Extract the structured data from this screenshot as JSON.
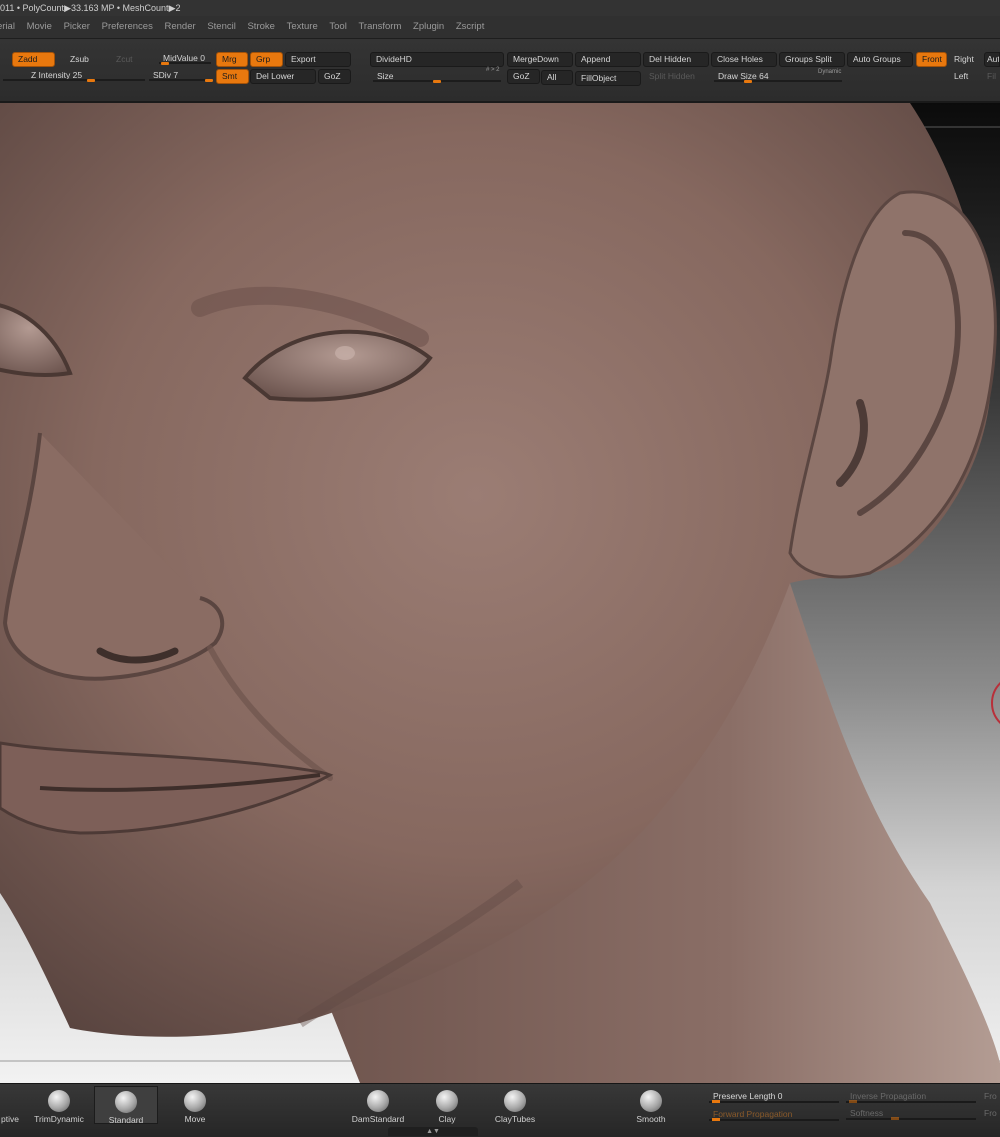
{
  "status": {
    "left_fragment": "011",
    "polycount_label": "PolyCount",
    "polycount_value": "33.163 MP",
    "meshcount_label": "MeshCount",
    "meshcount_value": "2"
  },
  "menu": [
    "erial",
    "Movie",
    "Picker",
    "Preferences",
    "Render",
    "Stencil",
    "Stroke",
    "Texture",
    "Tool",
    "Transform",
    "Zplugin",
    "Zscript"
  ],
  "toolbar": {
    "zadd": "Zadd",
    "zsub": "Zsub",
    "zcut": "Zcut",
    "z_intensity_label": "Z Intensity",
    "z_intensity_value": 25,
    "midvalue_label": "MidValue",
    "midvalue_value": 0,
    "sdiv_label": "SDiv",
    "sdiv_value": 7,
    "mrg": "Mrg",
    "grp": "Grp",
    "export": "Export",
    "smt": "Smt",
    "del_lower": "Del Lower",
    "goz_1": "GoZ",
    "dividehd": "DivideHD",
    "size_label": "Size",
    "size_hint": "# > 2",
    "mergedown": "MergeDown",
    "append": "Append",
    "goz_2": "GoZ",
    "all": "All",
    "fillobject": "FillObject",
    "del_hidden": "Del Hidden",
    "split_hidden": "Split Hidden",
    "close_holes": "Close Holes",
    "groups_split": "Groups Split",
    "auto_groups": "Auto Groups",
    "draw_size_label": "Draw Size",
    "draw_size_value": 64,
    "dynamic": "Dynamic",
    "front": "Front",
    "right": "Right",
    "left": "Left",
    "aut_fragment": "Aut",
    "fil_fragment": "Fil"
  },
  "brushes": [
    "ptive",
    "TrimDynamic",
    "Standard",
    "Move",
    "DamStandard",
    "Clay",
    "ClayTubes",
    "Smooth"
  ],
  "brush_props": {
    "preserve_length_label": "Preserve Length",
    "preserve_length_value": 0,
    "forward_propagation": "Forward Propagation",
    "inverse_propagation": "Inverse Propagation",
    "softness": "Softness",
    "fr_fragment_1": "Fro",
    "fr_fragment_2": "Fro"
  },
  "colors": {
    "accent": "#e8780e",
    "skin": "#8a6e66",
    "panel": "#2c2c2c"
  }
}
